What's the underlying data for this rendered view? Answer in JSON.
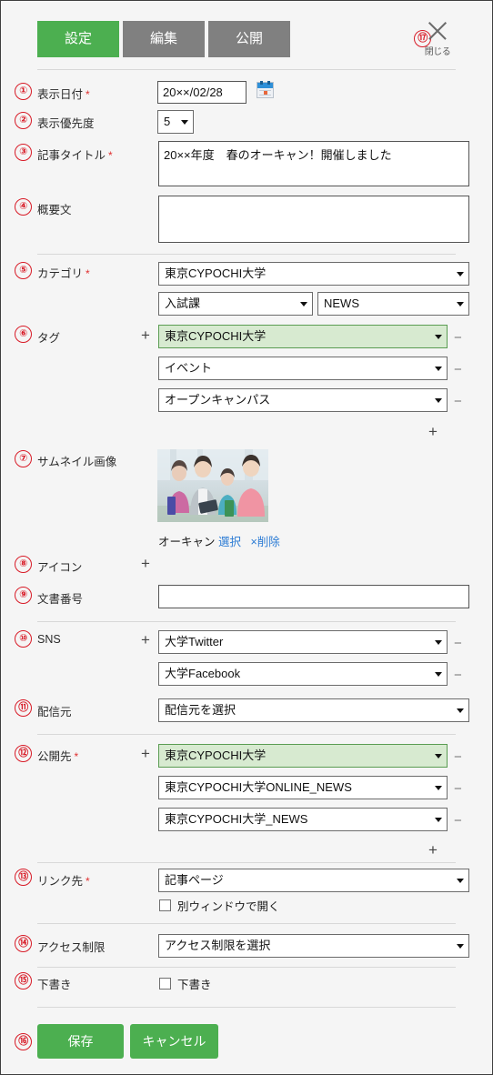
{
  "tabs": [
    {
      "label": "設定",
      "active": true
    },
    {
      "label": "編集",
      "active": false
    },
    {
      "label": "公開",
      "active": false
    }
  ],
  "close": {
    "marker": "⑰",
    "label": "閉じる",
    "icon": "close-icon"
  },
  "markers": {
    "m1": "①",
    "m2": "②",
    "m3": "③",
    "m4": "④",
    "m5": "⑤",
    "m6": "⑥",
    "m7": "⑦",
    "m8": "⑧",
    "m9": "⑨",
    "m10": "⑩",
    "m11": "⑪",
    "m12": "⑫",
    "m13": "⑬",
    "m14": "⑭",
    "m15": "⑮",
    "m16": "⑯"
  },
  "fields": {
    "display_date": {
      "label": "表示日付",
      "required": "*",
      "value": "20××/02/28",
      "icon": "calendar-icon"
    },
    "priority": {
      "label": "表示優先度",
      "value": "5"
    },
    "article_title": {
      "label": "記事タイトル",
      "required": "*",
      "value": "20××年度　春のオーキャン！開催しました",
      "placeholder": ""
    },
    "summary": {
      "label": "概要文",
      "value": "",
      "placeholder": ""
    },
    "category": {
      "label": "カテゴリ",
      "required": "*",
      "main": "東京CYPOCHI大学",
      "sub1": "入試課",
      "sub2": "NEWS"
    },
    "tags": {
      "label": "タグ",
      "add": "+",
      "remove": "−",
      "add_bottom": "+",
      "items": [
        {
          "value": "東京CYPOCHI大学",
          "highlight": true
        },
        {
          "value": "イベント",
          "highlight": false
        },
        {
          "value": "オープンキャンパス",
          "highlight": false
        }
      ]
    },
    "thumbnail": {
      "label": "サムネイル画像",
      "name": "オーキャン",
      "select_link": "選択",
      "delete_link": "×削除"
    },
    "icon": {
      "label": "アイコン",
      "add": "+"
    },
    "doc_number": {
      "label": "文書番号",
      "value": "",
      "placeholder": ""
    },
    "sns": {
      "label": "SNS",
      "add": "+",
      "remove": "−",
      "items": [
        {
          "value": "大学Twitter"
        },
        {
          "value": "大学Facebook"
        }
      ]
    },
    "source": {
      "label": "配信元",
      "value": "配信元を選択"
    },
    "publish_to": {
      "label": "公開先",
      "required": "*",
      "add": "+",
      "remove": "−",
      "add_bottom": "+",
      "items": [
        {
          "value": "東京CYPOCHI大学",
          "highlight": true
        },
        {
          "value": "東京CYPOCHI大学ONLINE_NEWS",
          "highlight": false
        },
        {
          "value": "東京CYPOCHI大学_NEWS",
          "highlight": false
        }
      ]
    },
    "link_to": {
      "label": "リンク先",
      "required": "*",
      "value": "記事ページ",
      "checkbox_label": "別ウィンドウで開く",
      "checked": false
    },
    "access": {
      "label": "アクセス制限",
      "value": "アクセス制限を選択"
    },
    "draft": {
      "label": "下書き",
      "checkbox_label": "下書き",
      "checked": false
    }
  },
  "footer": {
    "save": "保存",
    "cancel": "キャンセル"
  },
  "colors": {
    "accent_green": "#4caf50",
    "tab_inactive": "#808080",
    "marker_red": "#d81b27",
    "link_blue": "#2b7bd4",
    "highlight_green_bg": "#d7ead0"
  }
}
